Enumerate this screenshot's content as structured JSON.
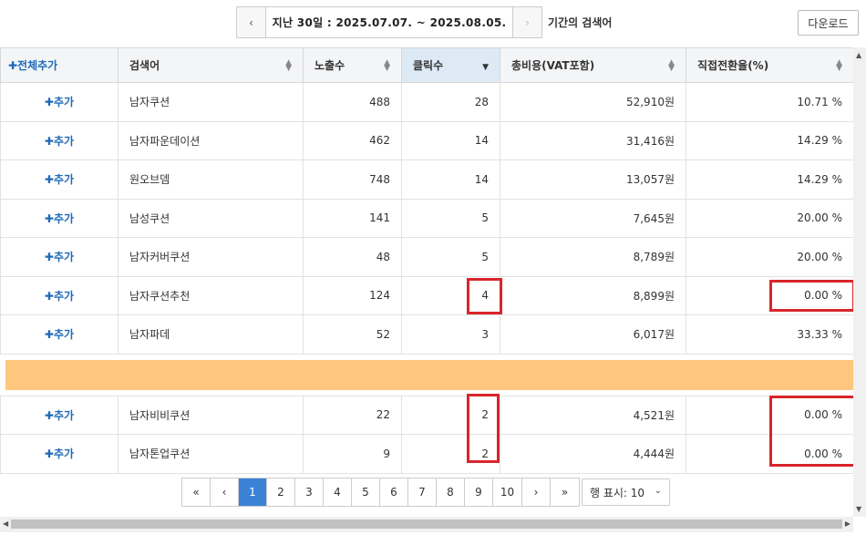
{
  "date_nav": {
    "prev_icon": "‹",
    "next_icon": "›",
    "range": "지난 30일 : 2025.07.07. ~ 2025.08.05.",
    "suffix": "기간의 검색어"
  },
  "download_label": "다운로드",
  "table": {
    "headers": {
      "add_all": "✚전체추가",
      "keyword": "검색어",
      "impressions": "노출수",
      "clicks": "클릭수",
      "total_cost": "총비용(VAT포함)",
      "conversion": "직접전환율(%)"
    },
    "add_label": "✚추가",
    "rows": [
      {
        "keyword": "남자쿠션",
        "impressions": "488",
        "clicks": "28",
        "cost": "52,910원",
        "conversion": "10.71 %"
      },
      {
        "keyword": "남자파운데이션",
        "impressions": "462",
        "clicks": "14",
        "cost": "31,416원",
        "conversion": "14.29 %"
      },
      {
        "keyword": "원오브뎀",
        "impressions": "748",
        "clicks": "14",
        "cost": "13,057원",
        "conversion": "14.29 %"
      },
      {
        "keyword": "남성쿠션",
        "impressions": "141",
        "clicks": "5",
        "cost": "7,645원",
        "conversion": "20.00 %"
      },
      {
        "keyword": "남자커버쿠션",
        "impressions": "48",
        "clicks": "5",
        "cost": "8,789원",
        "conversion": "20.00 %"
      },
      {
        "keyword": "남자쿠션추천",
        "impressions": "124",
        "clicks": "4",
        "cost": "8,899원",
        "conversion": "0.00 %"
      },
      {
        "keyword": "남자파데",
        "impressions": "52",
        "clicks": "3",
        "cost": "6,017원",
        "conversion": "33.33 %"
      },
      {
        "keyword": "남자비비쿠션",
        "impressions": "22",
        "clicks": "2",
        "cost": "4,521원",
        "conversion": "0.00 %"
      },
      {
        "keyword": "남자톤업쿠션",
        "impressions": "9",
        "clicks": "2",
        "cost": "4,444원",
        "conversion": "0.00 %"
      }
    ]
  },
  "pagination": {
    "first": "«",
    "prev": "‹",
    "pages": [
      "1",
      "2",
      "3",
      "4",
      "5",
      "6",
      "7",
      "8",
      "9",
      "10"
    ],
    "next": "›",
    "last": "»",
    "active_page": "1",
    "rows_per_page": "행 표시: 10"
  }
}
